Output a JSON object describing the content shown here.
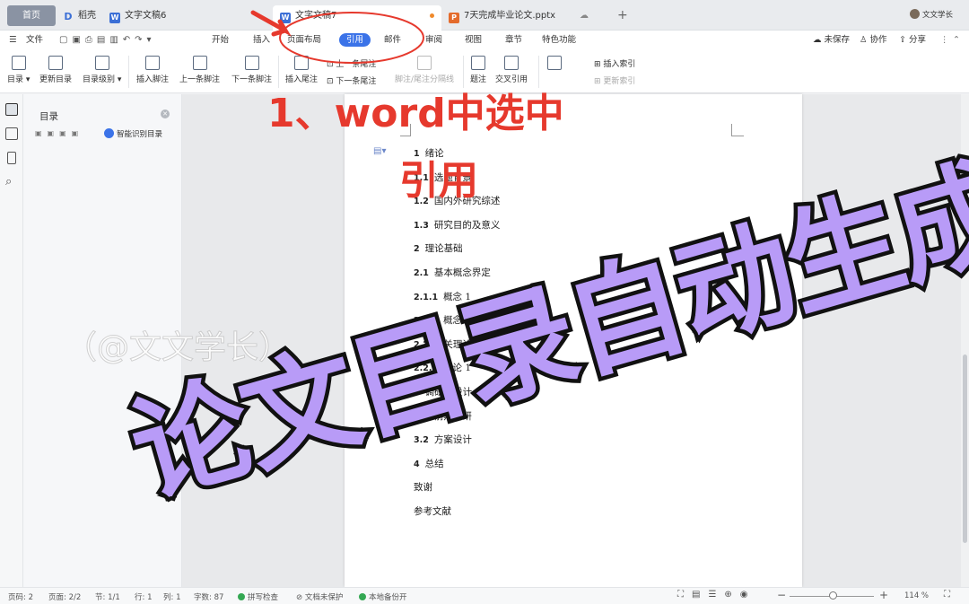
{
  "tabs": {
    "home": "首页",
    "docer": "稻壳",
    "doc6": "文字文稿6",
    "doc7": "文字文稿7",
    "pptx": "7天完成毕业论文.pptx",
    "add": "+",
    "user": "文文学长"
  },
  "menu": {
    "file": "文件",
    "items": [
      "开始",
      "插入",
      "页面布局",
      "引用",
      "邮件",
      "审阅",
      "视图",
      "章节",
      "特色功能"
    ],
    "active_index": 3,
    "unsaved": "未保存",
    "collab": "协作",
    "share": "分享"
  },
  "ribbon": {
    "toc": "目录",
    "update_toc": "更新目录",
    "toc_level": "目录级别",
    "insert_footnote": "插入脚注",
    "prev_footnote": "上一条脚注",
    "next_footnote": "下一条脚注",
    "insert_endnote": "插入尾注",
    "prev_endnote": "上一条尾注",
    "next_endnote": "下一条尾注",
    "separator": "脚注/尾注分隔线",
    "caption": "题注",
    "crossref": "交叉引用",
    "insert_index": "插入索引",
    "update_index": "更新索引"
  },
  "nav": {
    "title": "目录",
    "smart": "智能识别目录"
  },
  "toc": [
    {
      "num": "1",
      "text": "绪论"
    },
    {
      "num": "1.1",
      "text": "选题背景"
    },
    {
      "num": "1.2",
      "text": "国内外研究综述"
    },
    {
      "num": "1.3",
      "text": "研究目的及意义"
    },
    {
      "num": "2",
      "text": "理论基础"
    },
    {
      "num": "2.1",
      "text": "基本概念界定"
    },
    {
      "num": "2.1.1",
      "text": "概念 1"
    },
    {
      "num": "2.1.2",
      "text": "概念 2"
    },
    {
      "num": "2.2",
      "text": "相关理论"
    },
    {
      "num": "2.2.1",
      "text": "理论 1"
    },
    {
      "num": "3",
      "text": "调研与设计"
    },
    {
      "num": "3.1",
      "text": "前期调研"
    },
    {
      "num": "3.2",
      "text": "方案设计"
    },
    {
      "num": "4",
      "text": "总结"
    },
    {
      "num": "",
      "text": "致谢"
    },
    {
      "num": "",
      "text": "参考文献"
    }
  ],
  "status": {
    "page": "页码: 2",
    "pages": "页面: 2/2",
    "section": "节: 1/1",
    "row": "行: 1",
    "col": "列: 1",
    "words": "字数: 87",
    "spell": "拼写检查",
    "protect": "文档未保护",
    "backup": "本地备份开",
    "zoom": "114 %"
  },
  "annotation": {
    "step": "1、word中选中",
    "step2": "引用",
    "headline": "论文目录自动生成",
    "watermark": "（@文文学长）"
  },
  "colors": {
    "accent": "#3b73e8",
    "annotation_red": "#e6392d",
    "headline_fill": "#b89bf7"
  }
}
